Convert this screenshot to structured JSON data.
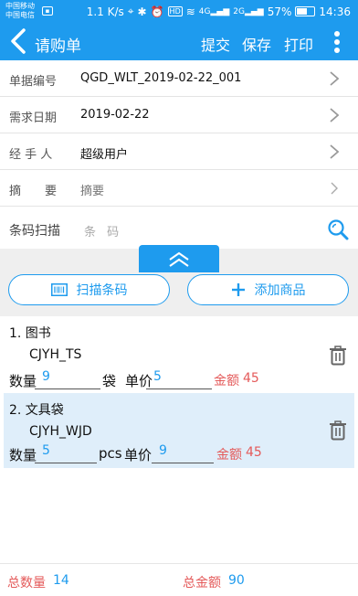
{
  "status": {
    "carrier1": "中国移动",
    "carrier2": "中国电信",
    "network_speed": "1.1 K/s",
    "signal_4g": "4G",
    "signal_2g": "2G",
    "battery": "57%",
    "battery_level": 0.57,
    "time": "14:36"
  },
  "header": {
    "title": "请购单",
    "submit_label": "提交",
    "save_label": "保存",
    "print_label": "打印"
  },
  "form": {
    "rows": [
      {
        "label": "单据编号",
        "value": "QGD_WLT_2019-02-22_001"
      },
      {
        "label": "需求日期",
        "value": "2019-02-22"
      },
      {
        "label": "经 手 人",
        "value": "超级用户"
      },
      {
        "label": "摘　　要",
        "value": "摘要"
      }
    ],
    "scan_label": "条码扫描",
    "scan_placeholder": "条 码"
  },
  "actions": {
    "scan_label": "扫描条码",
    "add_label": "添加商品"
  },
  "items": [
    {
      "name": "1.  图书",
      "code": "CJYH_TS",
      "qty_label": "数量",
      "qty": "9",
      "unit": "袋",
      "price_label": "单价",
      "price": "5",
      "amount_label": "金额",
      "amount": "45"
    },
    {
      "name": "2.  文具袋",
      "code": "CJYH_WJD",
      "qty_label": "数量",
      "qty": "5",
      "unit": "pcs",
      "price_label": "单价",
      "price": "9",
      "amount_label": "金额",
      "amount": "45"
    }
  ],
  "footer": {
    "total_qty_label": "总数量",
    "total_qty": "14",
    "total_amount_label": "总金额",
    "total_amount": "90"
  },
  "colors": {
    "primary": "#1e9bee",
    "amount": "#e45a5a",
    "highlight_row": "#dfeefa"
  }
}
